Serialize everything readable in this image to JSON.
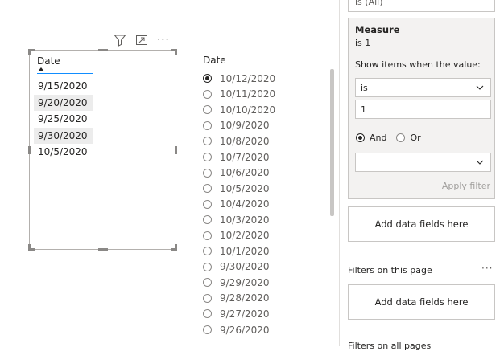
{
  "visual": {
    "toolbar": {
      "filter_icon": "filter-icon",
      "focus_icon": "focus-mode-icon",
      "more_icon": "more-options-icon",
      "more_label": "···"
    }
  },
  "table": {
    "header": "Date",
    "rows": [
      "9/15/2020",
      "9/20/2020",
      "9/25/2020",
      "9/30/2020",
      "10/5/2020"
    ]
  },
  "slicer": {
    "title": "Date",
    "selected_index": 0,
    "items": [
      "10/12/2020",
      "10/11/2020",
      "10/10/2020",
      "10/9/2020",
      "10/8/2020",
      "10/7/2020",
      "10/6/2020",
      "10/5/2020",
      "10/4/2020",
      "10/3/2020",
      "10/2/2020",
      "10/1/2020",
      "9/30/2020",
      "9/29/2020",
      "9/28/2020",
      "9/27/2020",
      "9/26/2020"
    ]
  },
  "filter_pane": {
    "top_card_text": "is (All)",
    "measure_card": {
      "title": "Measure",
      "subtitle": "is 1",
      "show_items_label": "Show items when the value:",
      "operator_value": "is",
      "value_input": "1",
      "and_label": "And",
      "or_label": "Or",
      "logic_selected": "And",
      "second_operator_value": "",
      "apply_label": "Apply filter"
    },
    "add_fields_label": "Add data fields here",
    "page_section": {
      "title": "Filters on this page",
      "more_label": "···",
      "add_fields_label": "Add data fields here"
    },
    "all_pages_title": "Filters on all pages"
  }
}
